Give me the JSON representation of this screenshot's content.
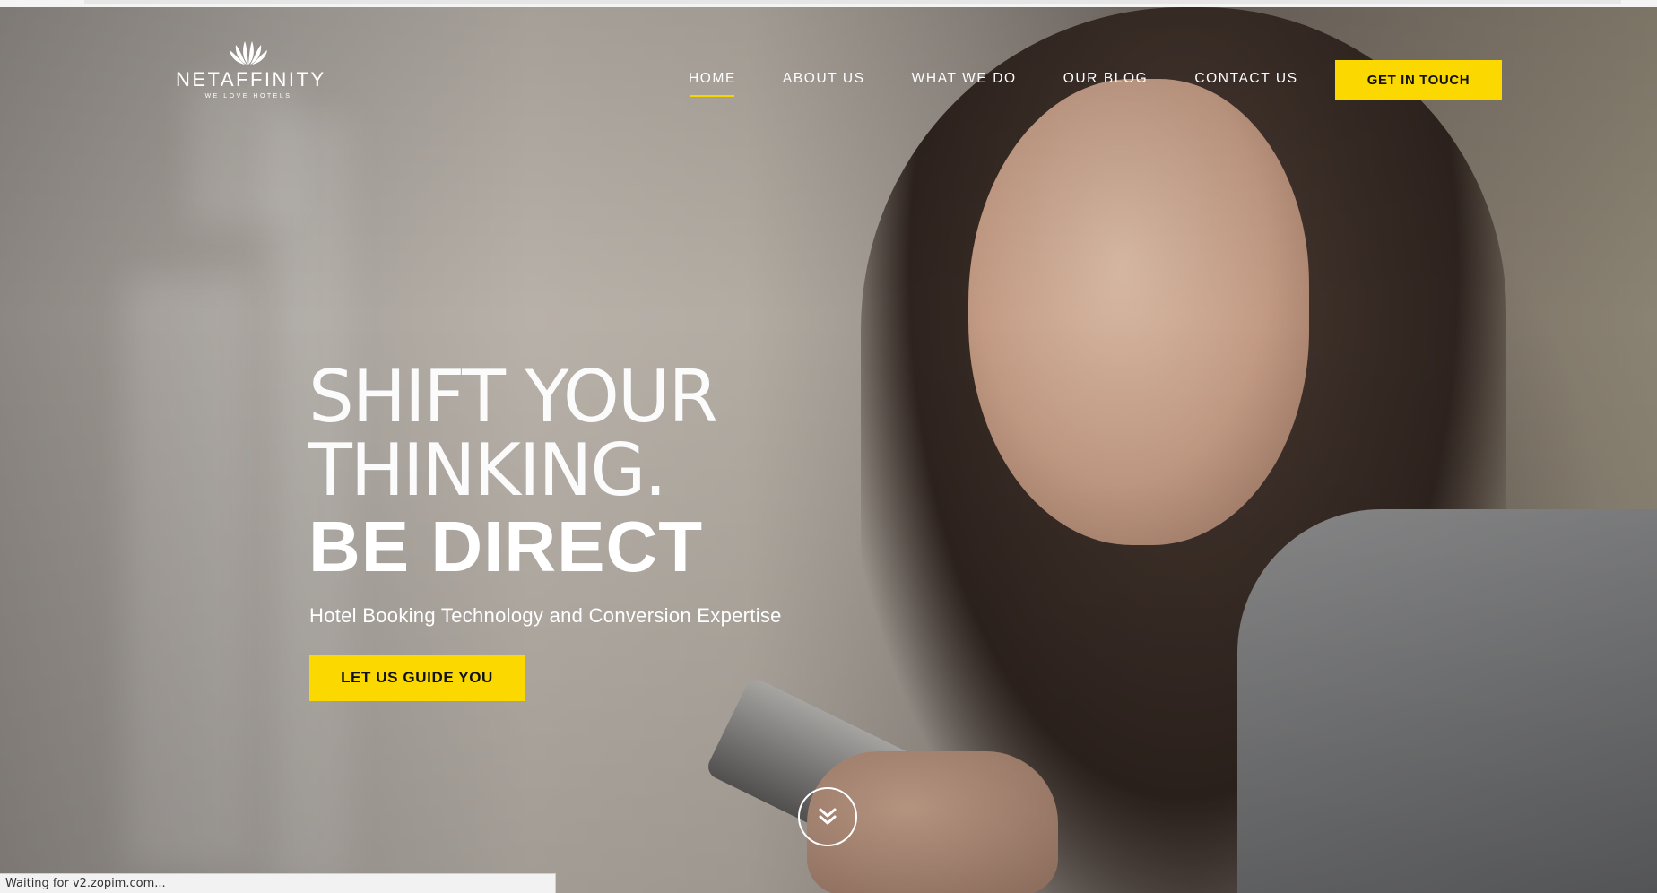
{
  "header": {
    "brand": "NETAFFINITY",
    "tagline": "WE LOVE HOTELS",
    "logo_icon": "lotus-logo-icon"
  },
  "nav": {
    "items": [
      {
        "label": "HOME",
        "active": true
      },
      {
        "label": "ABOUT US",
        "active": false
      },
      {
        "label": "WHAT WE DO",
        "active": false
      },
      {
        "label": "OUR BLOG",
        "active": false
      },
      {
        "label": "CONTACT US",
        "active": false
      }
    ],
    "cta": "GET IN TOUCH"
  },
  "hero": {
    "line1": "SHIFT YOUR",
    "line2": "THINKING.",
    "line3": "BE DIRECT",
    "subtitle": "Hotel Booking Technology and Conversion Expertise",
    "cta": "LET US GUIDE YOU",
    "scroll_icon": "double-chevron-down-icon"
  },
  "status_bar": {
    "text": "Waiting for v2.zopim.com..."
  },
  "colors": {
    "accent": "#fad800",
    "text": "#ffffff",
    "button_text": "#111111"
  }
}
